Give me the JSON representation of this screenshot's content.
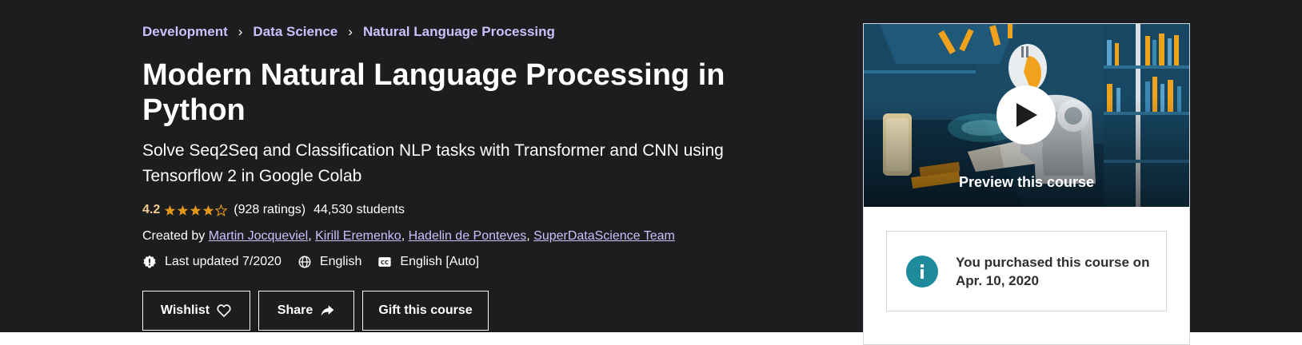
{
  "breadcrumb": [
    "Development",
    "Data Science",
    "Natural Language Processing"
  ],
  "course": {
    "title": "Modern Natural Language Processing in Python",
    "subtitle": "Solve Seq2Seq and Classification NLP tasks with Transformer and CNN using Tensorflow 2 in Google Colab",
    "rating": "4.2",
    "rating_fraction": 0.84,
    "stars_display": [
      1,
      1,
      1,
      1,
      0
    ],
    "ratings_count": "(928 ratings)",
    "students": "44,530 students",
    "created_by_label": "Created by",
    "instructors": [
      "Martin Jocqueviel",
      "Kirill Eremenko",
      "Hadelin de Ponteves",
      "SuperDataScience Team"
    ],
    "last_updated": "Last updated 7/2020",
    "language": "English",
    "captions": "English [Auto]"
  },
  "buttons": {
    "wishlist": "Wishlist",
    "share": "Share",
    "gift": "Gift this course"
  },
  "sidebar": {
    "preview_label": "Preview this course",
    "purchased_notice": "You purchased this course on Apr. 10, 2020"
  },
  "icons": {
    "star": "star-icon",
    "updated": "alert-badge-icon",
    "language": "globe-icon",
    "captions": "closed-captions-icon",
    "wishlist": "heart-icon",
    "share": "share-arrow-icon",
    "play": "play-icon",
    "info": "info-icon"
  },
  "colors": {
    "background": "#1c1d1f",
    "link": "#cec0fc",
    "rating": "#f3ca8c",
    "star": "#e59819",
    "info": "#1e8b9c"
  }
}
